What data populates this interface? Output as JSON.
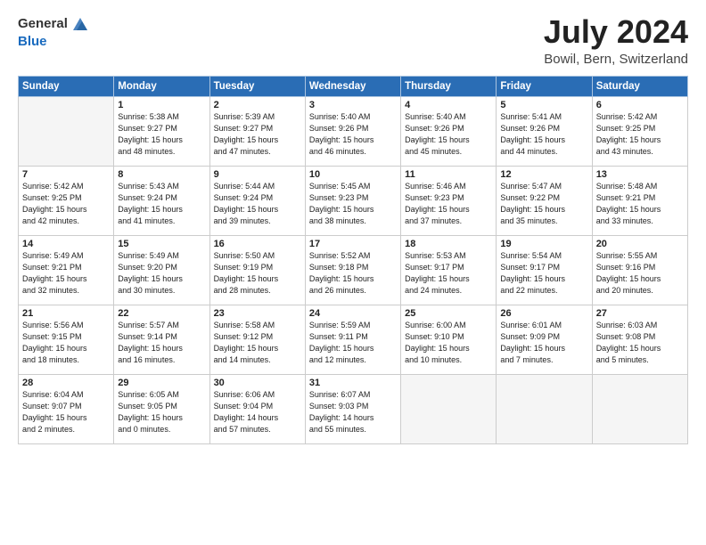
{
  "header": {
    "logo_general": "General",
    "logo_blue": "Blue",
    "title": "July 2024",
    "subtitle": "Bowil, Bern, Switzerland"
  },
  "columns": [
    "Sunday",
    "Monday",
    "Tuesday",
    "Wednesday",
    "Thursday",
    "Friday",
    "Saturday"
  ],
  "weeks": [
    [
      {
        "day": "",
        "sunrise": "",
        "sunset": "",
        "daylight": ""
      },
      {
        "day": "1",
        "sunrise": "Sunrise: 5:38 AM",
        "sunset": "Sunset: 9:27 PM",
        "daylight": "Daylight: 15 hours and 48 minutes."
      },
      {
        "day": "2",
        "sunrise": "Sunrise: 5:39 AM",
        "sunset": "Sunset: 9:27 PM",
        "daylight": "Daylight: 15 hours and 47 minutes."
      },
      {
        "day": "3",
        "sunrise": "Sunrise: 5:40 AM",
        "sunset": "Sunset: 9:26 PM",
        "daylight": "Daylight: 15 hours and 46 minutes."
      },
      {
        "day": "4",
        "sunrise": "Sunrise: 5:40 AM",
        "sunset": "Sunset: 9:26 PM",
        "daylight": "Daylight: 15 hours and 45 minutes."
      },
      {
        "day": "5",
        "sunrise": "Sunrise: 5:41 AM",
        "sunset": "Sunset: 9:26 PM",
        "daylight": "Daylight: 15 hours and 44 minutes."
      },
      {
        "day": "6",
        "sunrise": "Sunrise: 5:42 AM",
        "sunset": "Sunset: 9:25 PM",
        "daylight": "Daylight: 15 hours and 43 minutes."
      }
    ],
    [
      {
        "day": "7",
        "sunrise": "Sunrise: 5:42 AM",
        "sunset": "Sunset: 9:25 PM",
        "daylight": "Daylight: 15 hours and 42 minutes."
      },
      {
        "day": "8",
        "sunrise": "Sunrise: 5:43 AM",
        "sunset": "Sunset: 9:24 PM",
        "daylight": "Daylight: 15 hours and 41 minutes."
      },
      {
        "day": "9",
        "sunrise": "Sunrise: 5:44 AM",
        "sunset": "Sunset: 9:24 PM",
        "daylight": "Daylight: 15 hours and 39 minutes."
      },
      {
        "day": "10",
        "sunrise": "Sunrise: 5:45 AM",
        "sunset": "Sunset: 9:23 PM",
        "daylight": "Daylight: 15 hours and 38 minutes."
      },
      {
        "day": "11",
        "sunrise": "Sunrise: 5:46 AM",
        "sunset": "Sunset: 9:23 PM",
        "daylight": "Daylight: 15 hours and 37 minutes."
      },
      {
        "day": "12",
        "sunrise": "Sunrise: 5:47 AM",
        "sunset": "Sunset: 9:22 PM",
        "daylight": "Daylight: 15 hours and 35 minutes."
      },
      {
        "day": "13",
        "sunrise": "Sunrise: 5:48 AM",
        "sunset": "Sunset: 9:21 PM",
        "daylight": "Daylight: 15 hours and 33 minutes."
      }
    ],
    [
      {
        "day": "14",
        "sunrise": "Sunrise: 5:49 AM",
        "sunset": "Sunset: 9:21 PM",
        "daylight": "Daylight: 15 hours and 32 minutes."
      },
      {
        "day": "15",
        "sunrise": "Sunrise: 5:49 AM",
        "sunset": "Sunset: 9:20 PM",
        "daylight": "Daylight: 15 hours and 30 minutes."
      },
      {
        "day": "16",
        "sunrise": "Sunrise: 5:50 AM",
        "sunset": "Sunset: 9:19 PM",
        "daylight": "Daylight: 15 hours and 28 minutes."
      },
      {
        "day": "17",
        "sunrise": "Sunrise: 5:52 AM",
        "sunset": "Sunset: 9:18 PM",
        "daylight": "Daylight: 15 hours and 26 minutes."
      },
      {
        "day": "18",
        "sunrise": "Sunrise: 5:53 AM",
        "sunset": "Sunset: 9:17 PM",
        "daylight": "Daylight: 15 hours and 24 minutes."
      },
      {
        "day": "19",
        "sunrise": "Sunrise: 5:54 AM",
        "sunset": "Sunset: 9:17 PM",
        "daylight": "Daylight: 15 hours and 22 minutes."
      },
      {
        "day": "20",
        "sunrise": "Sunrise: 5:55 AM",
        "sunset": "Sunset: 9:16 PM",
        "daylight": "Daylight: 15 hours and 20 minutes."
      }
    ],
    [
      {
        "day": "21",
        "sunrise": "Sunrise: 5:56 AM",
        "sunset": "Sunset: 9:15 PM",
        "daylight": "Daylight: 15 hours and 18 minutes."
      },
      {
        "day": "22",
        "sunrise": "Sunrise: 5:57 AM",
        "sunset": "Sunset: 9:14 PM",
        "daylight": "Daylight: 15 hours and 16 minutes."
      },
      {
        "day": "23",
        "sunrise": "Sunrise: 5:58 AM",
        "sunset": "Sunset: 9:12 PM",
        "daylight": "Daylight: 15 hours and 14 minutes."
      },
      {
        "day": "24",
        "sunrise": "Sunrise: 5:59 AM",
        "sunset": "Sunset: 9:11 PM",
        "daylight": "Daylight: 15 hours and 12 minutes."
      },
      {
        "day": "25",
        "sunrise": "Sunrise: 6:00 AM",
        "sunset": "Sunset: 9:10 PM",
        "daylight": "Daylight: 15 hours and 10 minutes."
      },
      {
        "day": "26",
        "sunrise": "Sunrise: 6:01 AM",
        "sunset": "Sunset: 9:09 PM",
        "daylight": "Daylight: 15 hours and 7 minutes."
      },
      {
        "day": "27",
        "sunrise": "Sunrise: 6:03 AM",
        "sunset": "Sunset: 9:08 PM",
        "daylight": "Daylight: 15 hours and 5 minutes."
      }
    ],
    [
      {
        "day": "28",
        "sunrise": "Sunrise: 6:04 AM",
        "sunset": "Sunset: 9:07 PM",
        "daylight": "Daylight: 15 hours and 2 minutes."
      },
      {
        "day": "29",
        "sunrise": "Sunrise: 6:05 AM",
        "sunset": "Sunset: 9:05 PM",
        "daylight": "Daylight: 15 hours and 0 minutes."
      },
      {
        "day": "30",
        "sunrise": "Sunrise: 6:06 AM",
        "sunset": "Sunset: 9:04 PM",
        "daylight": "Daylight: 14 hours and 57 minutes."
      },
      {
        "day": "31",
        "sunrise": "Sunrise: 6:07 AM",
        "sunset": "Sunset: 9:03 PM",
        "daylight": "Daylight: 14 hours and 55 minutes."
      },
      {
        "day": "",
        "sunrise": "",
        "sunset": "",
        "daylight": ""
      },
      {
        "day": "",
        "sunrise": "",
        "sunset": "",
        "daylight": ""
      },
      {
        "day": "",
        "sunrise": "",
        "sunset": "",
        "daylight": ""
      }
    ]
  ]
}
